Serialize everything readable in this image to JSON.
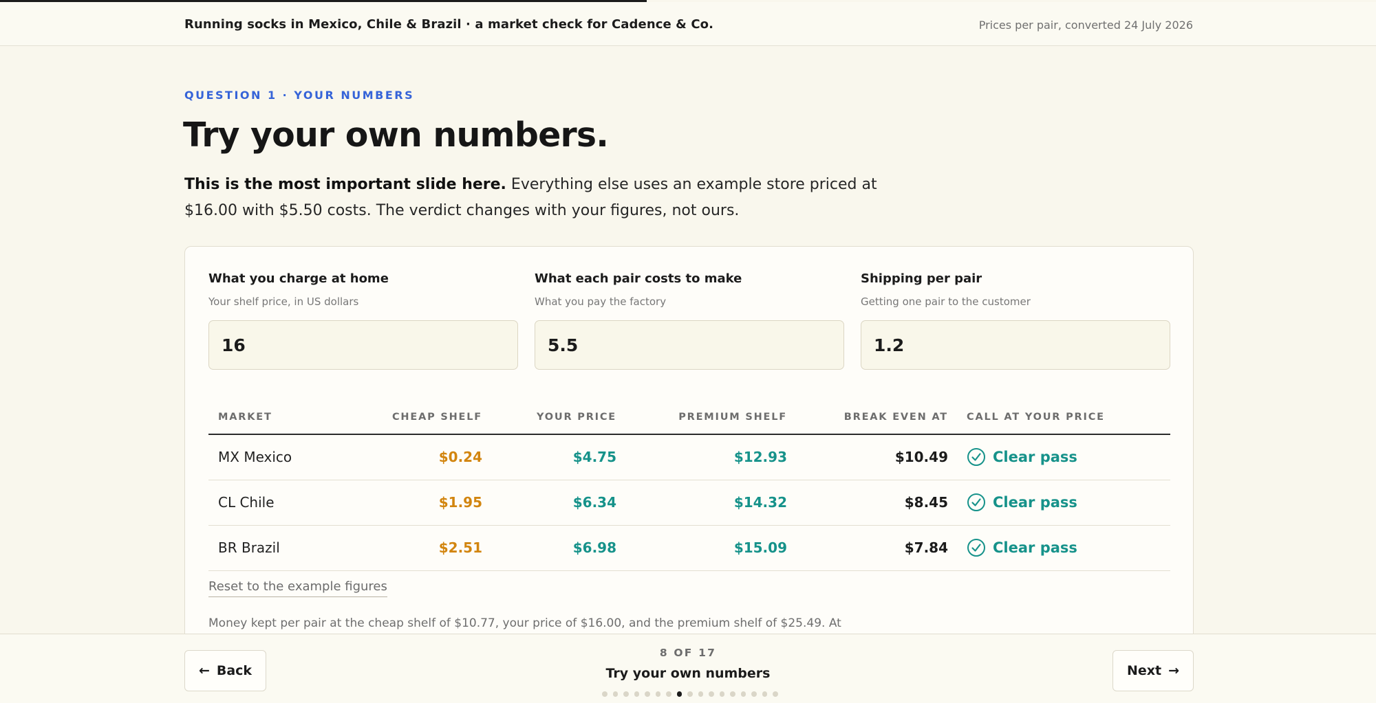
{
  "header": {
    "deck_title": "Running socks in Mexico, Chile & Brazil · a market check for Cadence & Co.",
    "note": "Prices per pair, converted 24 July 2026",
    "progress_fraction": 0.47
  },
  "slide": {
    "eyebrow": "QUESTION 1 · YOUR NUMBERS",
    "headline": "Try your own numbers.",
    "intro_bold": "This is the most important slide here.",
    "intro_rest": " Everything else uses an example store priced at $16.00 with $5.50 costs. The verdict changes with your figures, not ours."
  },
  "inputs": [
    {
      "label": "What you charge at home",
      "hint": "Your shelf price, in US dollars",
      "value": "16"
    },
    {
      "label": "What each pair costs to make",
      "hint": "What you pay the factory",
      "value": "5.5"
    },
    {
      "label": "Shipping per pair",
      "hint": "Getting one pair to the customer",
      "value": "1.2"
    }
  ],
  "table": {
    "headers": {
      "market": "MARKET",
      "cheap": "CHEAP SHELF",
      "your_price": "YOUR PRICE",
      "premium": "PREMIUM SHELF",
      "break_even": "BREAK EVEN AT",
      "call": "CALL AT YOUR PRICE"
    },
    "rows": [
      {
        "market": "MX Mexico",
        "cheap": "$0.24",
        "your_price": "$4.75",
        "premium": "$12.93",
        "break_even": "$10.49",
        "call": "Clear pass"
      },
      {
        "market": "CL Chile",
        "cheap": "$1.95",
        "your_price": "$6.34",
        "premium": "$14.32",
        "break_even": "$8.45",
        "call": "Clear pass"
      },
      {
        "market": "BR Brazil",
        "cheap": "$2.51",
        "your_price": "$6.98",
        "premium": "$15.09",
        "break_even": "$7.84",
        "call": "Clear pass"
      }
    ]
  },
  "reset_label": "Reset to the example figures",
  "footnote": "Money kept per pair at the cheap shelf of $10.77, your price of $16.00, and the premium shelf of $25.49. At",
  "footer": {
    "back_label": "Back",
    "back_arrow": "←",
    "next_label": "Next",
    "next_arrow": "→",
    "counter": "8 OF 17",
    "slide_name": "Try your own numbers",
    "total_slides": 17,
    "current_slide": 8
  },
  "colors": {
    "accent_blue": "#3563d8",
    "cheap_orange": "#d2850f",
    "pass_teal": "#16928a",
    "background": "#f9f7ed"
  }
}
